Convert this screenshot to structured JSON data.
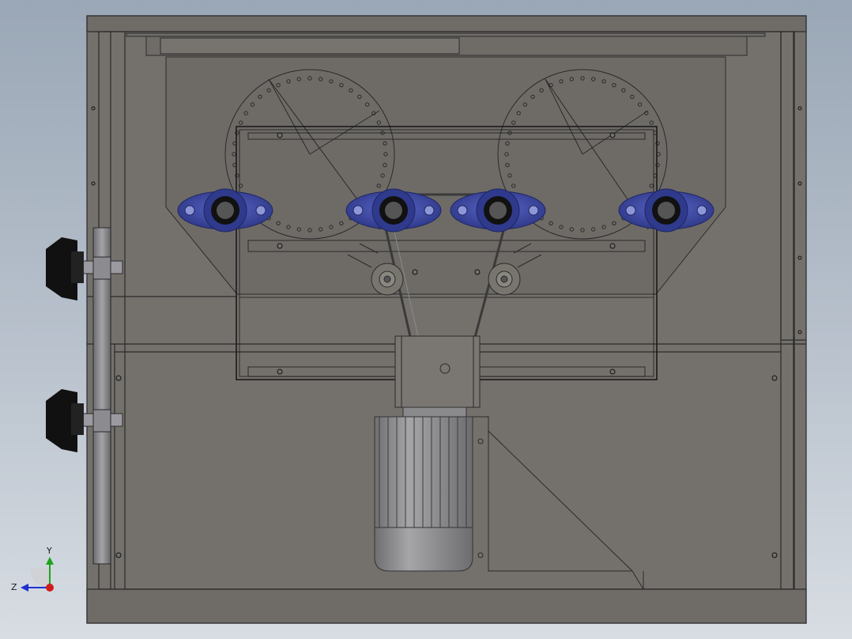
{
  "viewport": {
    "background_top": "#9aa7b6",
    "background_bottom": "#d8dde3"
  },
  "colors": {
    "body": "#74716c",
    "body_dark": "#66635f",
    "line": "#2a2a2a",
    "bearing": "#3e4aa6",
    "bearing_dark": "#26306e",
    "knob": "#111111",
    "motor": "#8e8d8f",
    "motor_dark": "#6d6c6f"
  },
  "triad": {
    "y_label": "Y",
    "z_label": "Z",
    "y_color": "#1fa31f",
    "z_color": "#1f2fd0",
    "x_color": "#d01c1c"
  }
}
